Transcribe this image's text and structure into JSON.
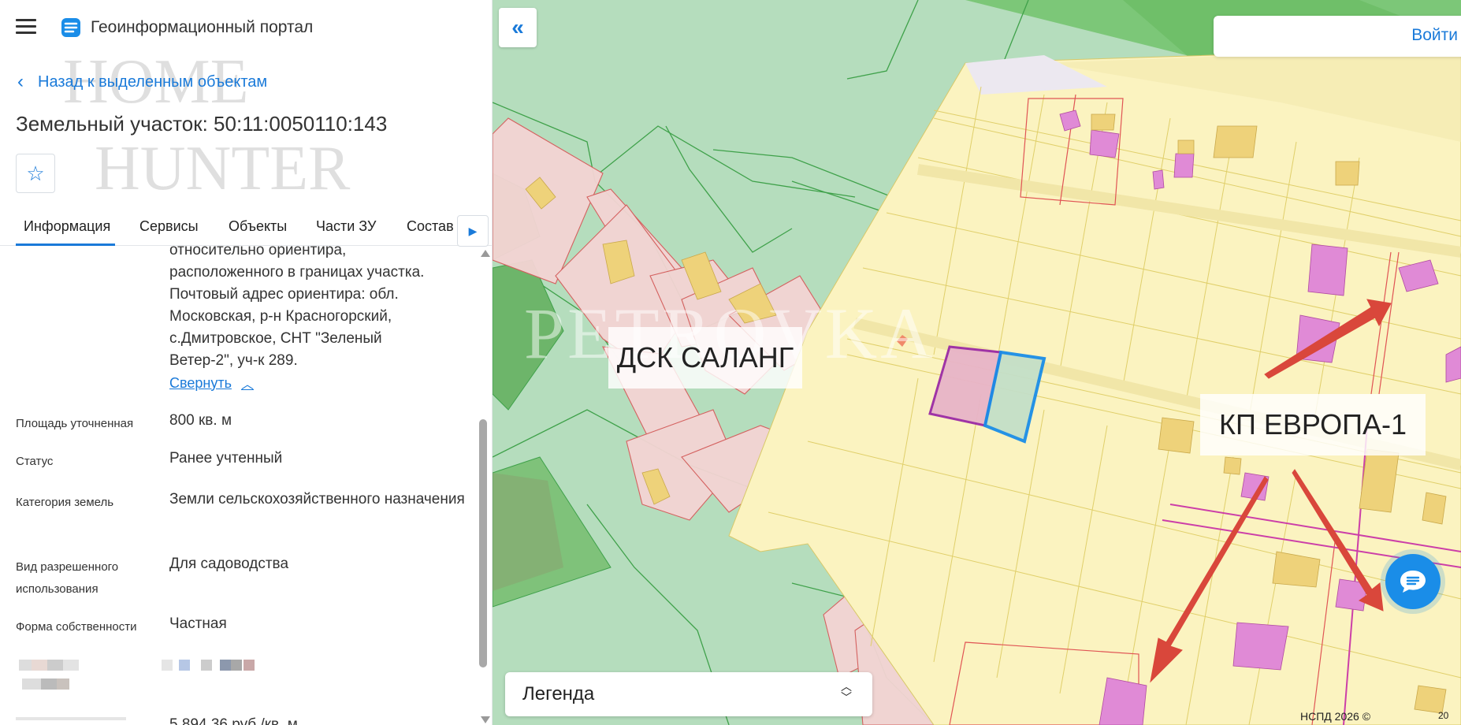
{
  "app": {
    "title": "Геоинформационный портал",
    "menu_icon": "hamburger-menu-icon",
    "logo_icon": "geoportal-logo-icon"
  },
  "panel": {
    "back_label": "Назад к выделенным объектам",
    "title": "Земельный участок: 50:11:0050110:143",
    "favorite_icon": "star-outline-icon",
    "tabs": [
      {
        "label": "Информация",
        "active": true
      },
      {
        "label": "Сервисы"
      },
      {
        "label": "Объекты"
      },
      {
        "label": "Части ЗУ"
      },
      {
        "label": "Состав"
      }
    ],
    "address_text": "относительно ориентира,\nрасположенного в границах участка.\nПочтовый адрес ориентира: обл.\nМосковская, р-н Красногорский,\nс.Дмитровское, СНТ \"Зеленый\nВетер-2\", уч-к 289.",
    "collapse_label": "Свернуть",
    "fields": [
      {
        "label": "Площадь уточненная",
        "value": "800 кв. м"
      },
      {
        "label": "Статус",
        "value": "Ранее учтенный"
      },
      {
        "label": "Категория земель",
        "value": "Земли сельскохозяйственного назначения"
      },
      {
        "label": "Вид разрешенного использования",
        "value": "Для садоводства"
      },
      {
        "label": "Форма собственности",
        "value": "Частная"
      }
    ],
    "partial_value": "5 894,36 руб./кв. м"
  },
  "map": {
    "login_label": "Войти",
    "labels": [
      "ДСК САЛАНГ",
      "КП ЕВРОПА-1"
    ],
    "legend_label": "Легенда",
    "copyright": "НСПД 2026 ©",
    "scale": "20",
    "watermark": "PETROVKA"
  },
  "colors": {
    "accent": "#1a7ad9",
    "forest": "#b8dfc0",
    "parcel_yellow": "#fbf3c0",
    "building_pink": "#e08ad6",
    "selected_border": "#1a8de8",
    "arrow_red": "#d9473b"
  }
}
